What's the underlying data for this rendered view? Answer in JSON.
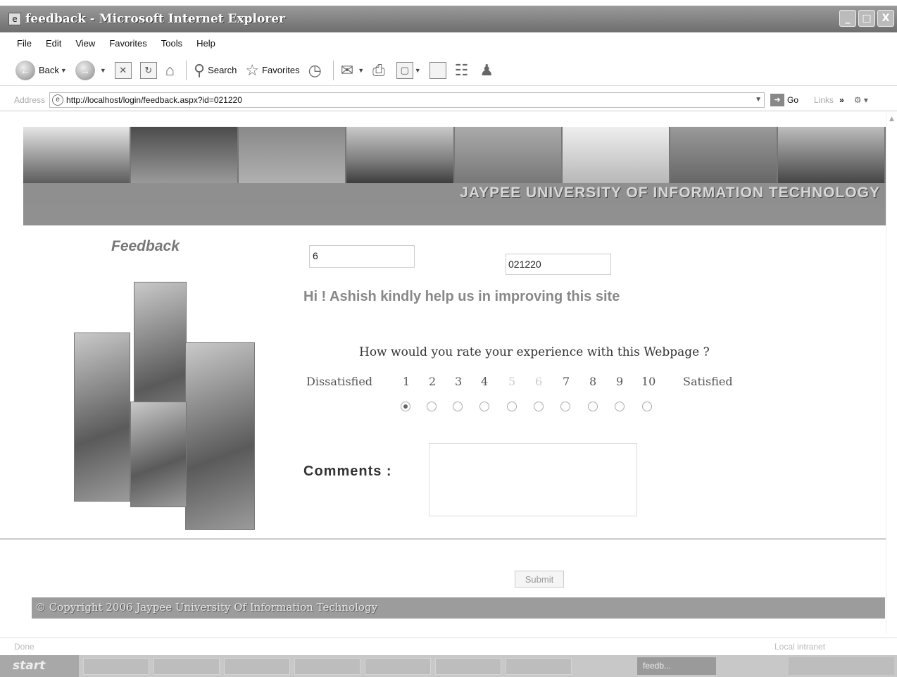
{
  "window": {
    "title": "feedback - Microsoft Internet Explorer",
    "controls": {
      "minimize": "_",
      "maximize": "□",
      "close": "X"
    }
  },
  "menubar": {
    "items": [
      "File",
      "Edit",
      "View",
      "Favorites",
      "Tools",
      "Help"
    ]
  },
  "toolbar": {
    "back_label": "Back",
    "search_label": "Search",
    "favorites_label": "Favorites"
  },
  "address": {
    "label": "Address",
    "url": "http://localhost/login/feedback.aspx?id=021220",
    "go_label": "Go",
    "links_label": "Links",
    "links_chevron": "»"
  },
  "banner": {
    "title": "JAYPEE UNIVERSITY OF INFORMATION TECHNOLOGY"
  },
  "page": {
    "heading": "Feedback",
    "field_one_value": "6",
    "field_two_value": "021220",
    "greeting": "Hi ! Ashish kindly help us in improving this site",
    "rating": {
      "question": "How would you rate your experience with this Webpage ?",
      "low_label": "Dissatisfied",
      "high_label": "Satisfied",
      "scale": [
        "1",
        "2",
        "3",
        "4",
        "5",
        "6",
        "7",
        "8",
        "9",
        "10"
      ],
      "selected": "1"
    },
    "comments_label": "Comments :",
    "comments_value": "",
    "submit_label": "Submit",
    "copyright": "© Copyright 2006 Jaypee University Of Information Technology"
  },
  "statusbar": {
    "left": "Done",
    "right": "Local intranet"
  },
  "taskbar": {
    "start_label": "start",
    "active_item": "feedb..."
  }
}
